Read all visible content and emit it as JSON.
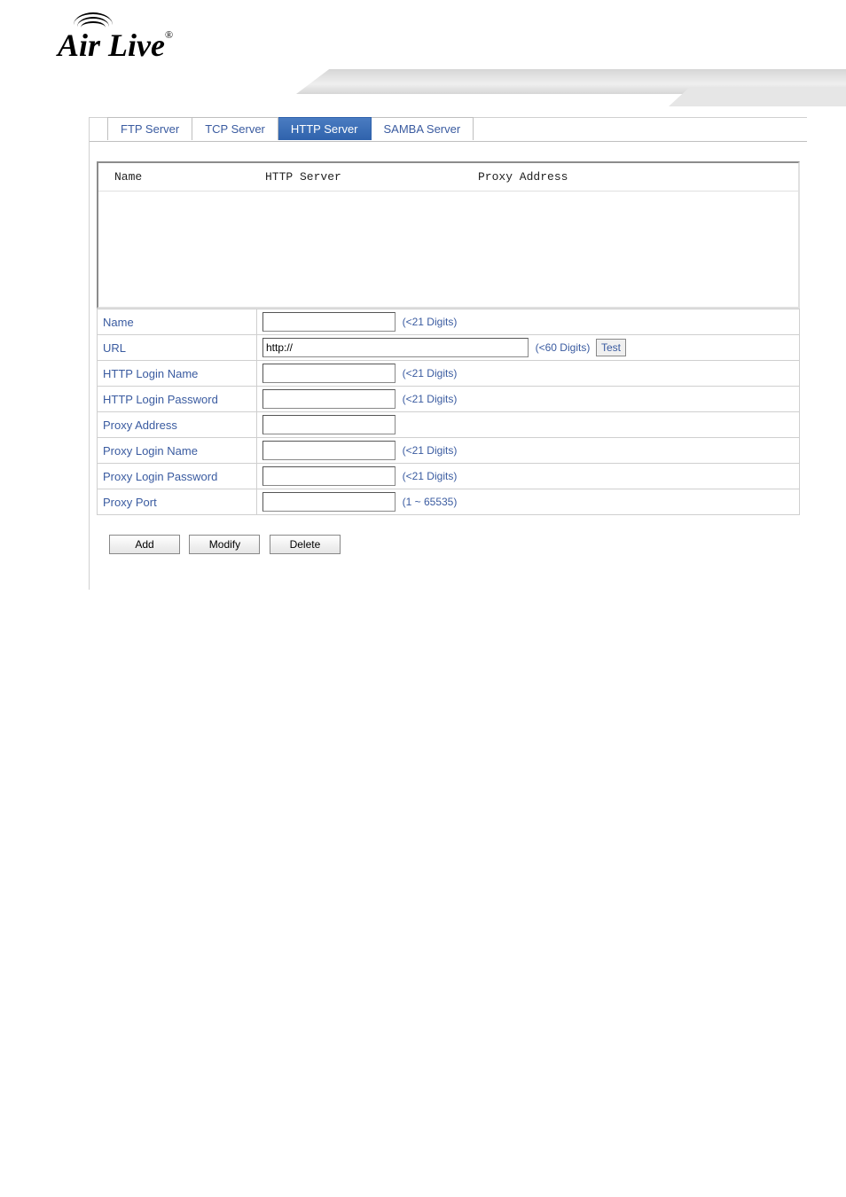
{
  "brand": {
    "name": "Air Live",
    "registered": "®"
  },
  "tabs": [
    {
      "label": "FTP Server"
    },
    {
      "label": "TCP Server"
    },
    {
      "label": "HTTP Server"
    },
    {
      "label": "SAMBA Server"
    }
  ],
  "list_headers": {
    "name": "Name",
    "http_server": "HTTP Server",
    "proxy_address": "Proxy Address"
  },
  "form": {
    "name": {
      "label": "Name",
      "value": "",
      "constraint": "(<21 Digits)"
    },
    "url": {
      "label": "URL",
      "value": "http://",
      "constraint": "(<60 Digits)",
      "test_label": "Test"
    },
    "http_login_name": {
      "label": "HTTP Login Name",
      "value": "",
      "constraint": "(<21 Digits)"
    },
    "http_login_password": {
      "label": "HTTP Login Password",
      "value": "",
      "constraint": "(<21 Digits)"
    },
    "proxy_address": {
      "label": "Proxy Address",
      "value": "",
      "constraint": ""
    },
    "proxy_login_name": {
      "label": "Proxy Login Name",
      "value": "",
      "constraint": "(<21 Digits)"
    },
    "proxy_login_password": {
      "label": "Proxy Login Password",
      "value": "",
      "constraint": "(<21 Digits)"
    },
    "proxy_port": {
      "label": "Proxy Port",
      "value": "",
      "constraint": "(1 ~ 65535)"
    }
  },
  "buttons": {
    "add": "Add",
    "modify": "Modify",
    "delete": "Delete"
  }
}
